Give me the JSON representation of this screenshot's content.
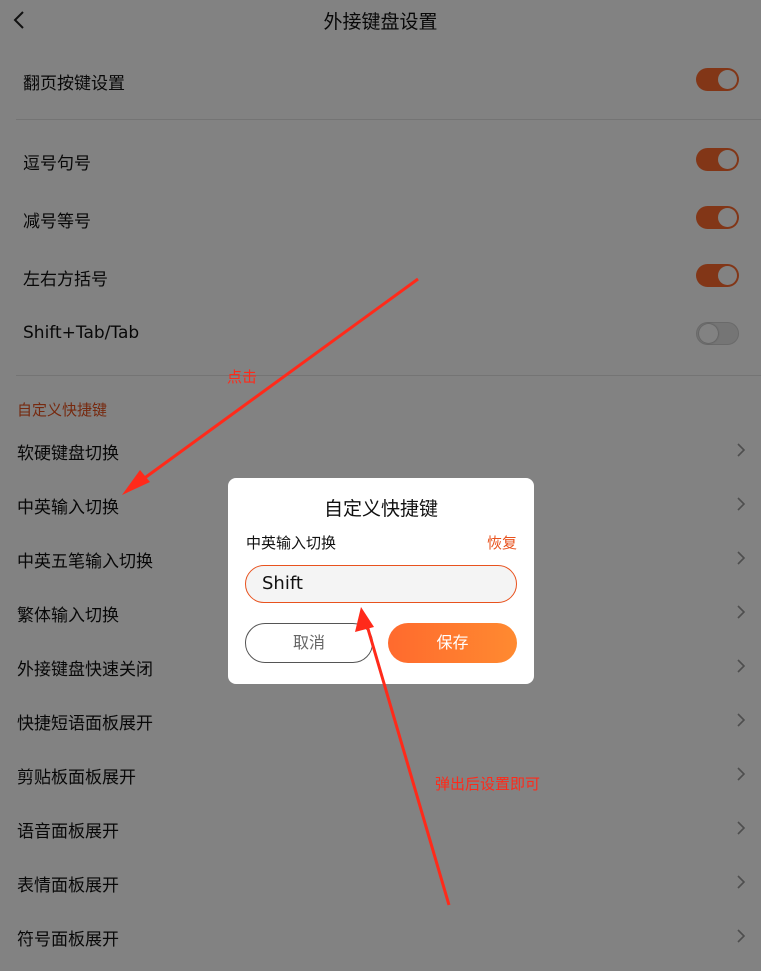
{
  "header": {
    "title": "外接键盘设置",
    "back_icon": "chevron-left-icon"
  },
  "settings": {
    "page_turn": {
      "label": "翻页按键设置",
      "enabled": true
    },
    "toggles": [
      {
        "label": "逗号句号",
        "enabled": true
      },
      {
        "label": "减号等号",
        "enabled": true
      },
      {
        "label": "左右方括号",
        "enabled": true
      },
      {
        "label": "Shift+Tab/Tab",
        "enabled": false
      }
    ]
  },
  "custom_shortcuts": {
    "section_title": "自定义快捷键",
    "items": [
      {
        "label": "软硬键盘切换"
      },
      {
        "label": "中英输入切换"
      },
      {
        "label": "中英五笔输入切换"
      },
      {
        "label": "繁体输入切换"
      },
      {
        "label": "外接键盘快速关闭"
      },
      {
        "label": "快捷短语面板展开"
      },
      {
        "label": "剪贴板面板展开"
      },
      {
        "label": "语音面板展开"
      },
      {
        "label": "表情面板展开"
      },
      {
        "label": "符号面板展开"
      }
    ]
  },
  "dialog": {
    "title": "自定义快捷键",
    "subtitle": "中英输入切换",
    "reset_label": "恢复",
    "input_value": "Shift",
    "cancel_label": "取消",
    "save_label": "保存"
  },
  "annotations": {
    "click_hint": "点击",
    "popup_hint": "弹出后设置即可"
  },
  "colors": {
    "accent": "#ff6a2e",
    "accent_text": "#e8521e",
    "annotation": "#ff2a1a",
    "overlay": "rgba(0,0,0,0.49)"
  }
}
